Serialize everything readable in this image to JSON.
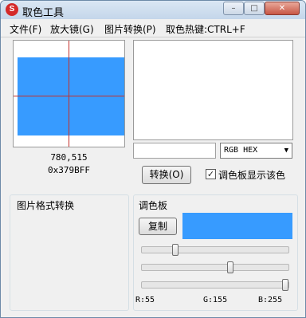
{
  "window": {
    "title": "取色工具",
    "min_symbol": "–",
    "max_symbol": "□",
    "close_symbol": "✕"
  },
  "menu": [
    "文件(F)",
    "放大镜(G)",
    "图片转换(P)",
    "取色热键:CTRL+F"
  ],
  "picker": {
    "coords": "780,515",
    "hex": "0x379BFF",
    "color": "#379BFF"
  },
  "format": {
    "selected": "RGB HEX"
  },
  "convert_label": "转换(O)",
  "checkbox": {
    "checked": true,
    "mark": "✓",
    "label": "调色板显示该色"
  },
  "image_group_title": "图片格式转换",
  "palette": {
    "title": "调色板",
    "copy_label": "复制",
    "color": "#379BFF",
    "r": 55,
    "g": 155,
    "b": 255,
    "r_label": "R:55",
    "g_label": "G:155",
    "b_label": "B:255"
  }
}
